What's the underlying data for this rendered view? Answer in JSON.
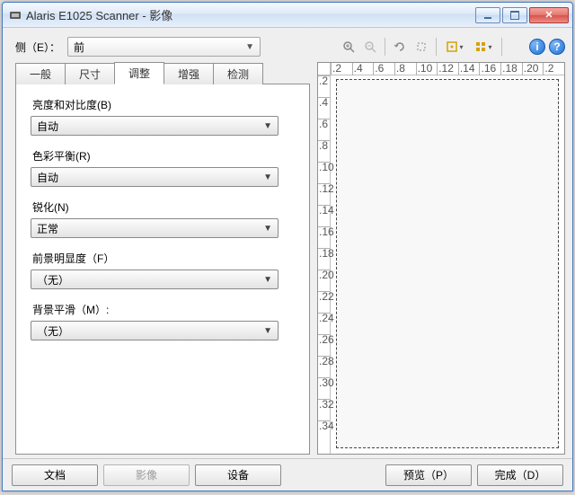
{
  "window": {
    "title": "Alaris E1025 Scanner - 影像"
  },
  "side": {
    "label": "侧（E）：",
    "value": "前"
  },
  "tabs": {
    "general": "一般",
    "size": "尺寸",
    "adjust": "调整",
    "enhance": "增强",
    "detect": "检测"
  },
  "fields": {
    "brightness": {
      "label": "亮度和对比度(B)",
      "value": "自动"
    },
    "colorbalance": {
      "label": "色彩平衡(R)",
      "value": "自动"
    },
    "sharpen": {
      "label": "锐化(N)",
      "value": "正常"
    },
    "foreground": {
      "label": "前景明显度（F）",
      "value": "（无）"
    },
    "background": {
      "label": "背景平滑（M）:",
      "value": "（无）"
    }
  },
  "ruler_h": [
    ".2",
    ".4",
    ".6",
    ".8",
    ".10",
    ".12",
    ".14",
    ".16",
    ".18",
    ".20",
    ".2"
  ],
  "ruler_v": [
    ".2",
    ".4",
    ".6",
    ".8",
    ".10",
    ".12",
    ".14",
    ".16",
    ".18",
    ".20",
    ".22",
    ".24",
    ".26",
    ".28",
    ".30",
    ".32",
    ".34"
  ],
  "bottom": {
    "document": "文档",
    "image": "影像",
    "device": "设备",
    "preview": "预览（P）",
    "done": "完成（D）"
  },
  "icons": {
    "help": "i",
    "q": "?"
  }
}
